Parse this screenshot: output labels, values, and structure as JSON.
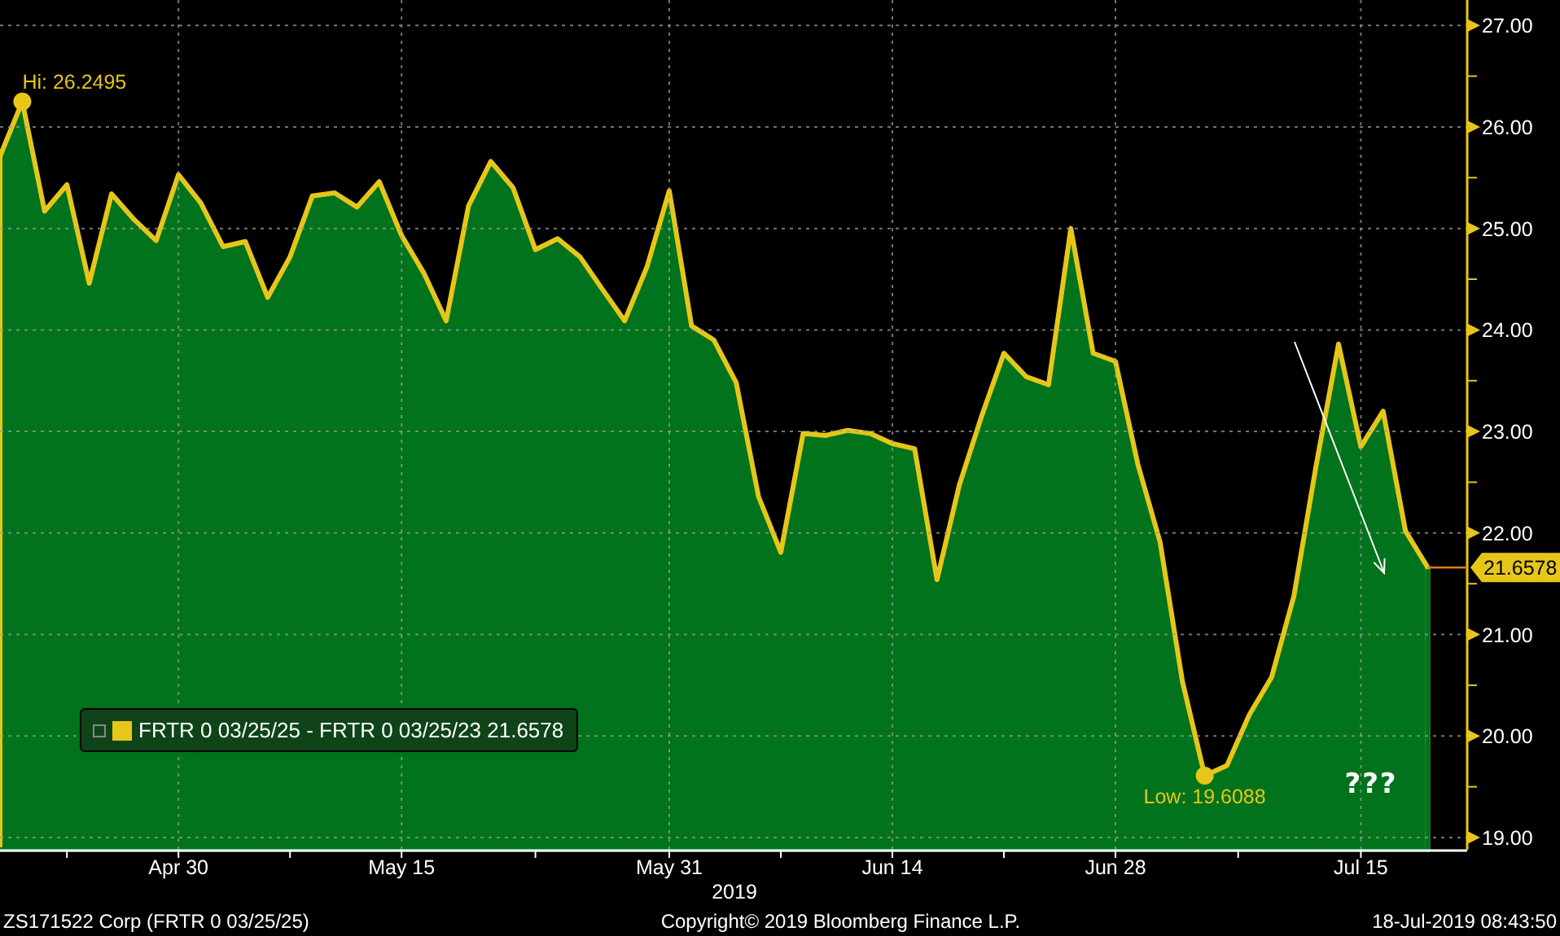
{
  "chart": {
    "chart_data": {
      "type": "area",
      "xlabel": "2019",
      "grid": true,
      "categories": [
        null,
        null,
        null,
        null,
        null,
        null,
        null,
        null,
        "Apr 30",
        null,
        null,
        null,
        null,
        null,
        null,
        null,
        null,
        null,
        "May 15",
        null,
        null,
        null,
        null,
        null,
        null,
        null,
        null,
        null,
        null,
        null,
        "May 31",
        null,
        null,
        null,
        null,
        null,
        null,
        null,
        null,
        null,
        "Jun 14",
        null,
        null,
        null,
        null,
        null,
        null,
        null,
        null,
        null,
        "Jun 28",
        null,
        null,
        null,
        null,
        null,
        null,
        null,
        null,
        null,
        null,
        "Jul 15",
        null,
        null,
        null
      ],
      "series": [
        {
          "name": "FRTR 0 03/25/25 - FRTR 0 03/25/23",
          "color": "#00731c",
          "values": [
            25.71,
            26.25,
            25.17,
            25.43,
            24.46,
            25.34,
            25.09,
            24.88,
            25.53,
            25.25,
            24.82,
            24.87,
            24.32,
            24.72,
            25.32,
            25.35,
            25.21,
            25.46,
            24.93,
            24.56,
            24.09,
            25.22,
            25.66,
            25.4,
            24.79,
            24.9,
            24.72,
            24.4,
            24.09,
            24.62,
            25.37,
            24.04,
            23.9,
            23.48,
            22.36,
            21.81,
            22.98,
            22.96,
            23.01,
            22.98,
            22.88,
            22.83,
            21.54,
            22.47,
            23.15,
            23.77,
            23.54,
            23.46,
            25.0,
            23.77,
            23.69,
            22.68,
            21.91,
            20.54,
            19.61,
            19.71,
            20.21,
            20.58,
            21.38,
            22.67,
            23.86,
            22.85,
            23.2,
            22.02,
            21.66
          ]
        }
      ],
      "ylim": [
        18.88,
        27.25
      ],
      "yticks": [
        {
          "value": 19,
          "label": "19.00"
        },
        {
          "value": 20,
          "label": "20.00"
        },
        {
          "value": 21,
          "label": "21.00"
        },
        {
          "value": 22,
          "label": "22.00"
        },
        {
          "value": 23,
          "label": "23.00"
        },
        {
          "value": 24,
          "label": "24.00"
        },
        {
          "value": 25,
          "label": "25.00"
        },
        {
          "value": 26,
          "label": "26.00"
        },
        {
          "value": 27,
          "label": "27.00"
        }
      ],
      "annotations": [
        "Hi: 26.2495",
        "Low: 19.6088",
        "???"
      ]
    },
    "last_value": "21.6578",
    "legend": {
      "value": "21.6578"
    }
  },
  "footer": {
    "left": "ZS171522 Corp (FRTR 0 03/25/25)",
    "center": "Copyright© 2019 Bloomberg Finance L.P.",
    "right": "18-Jul-2019 08:43:50"
  }
}
